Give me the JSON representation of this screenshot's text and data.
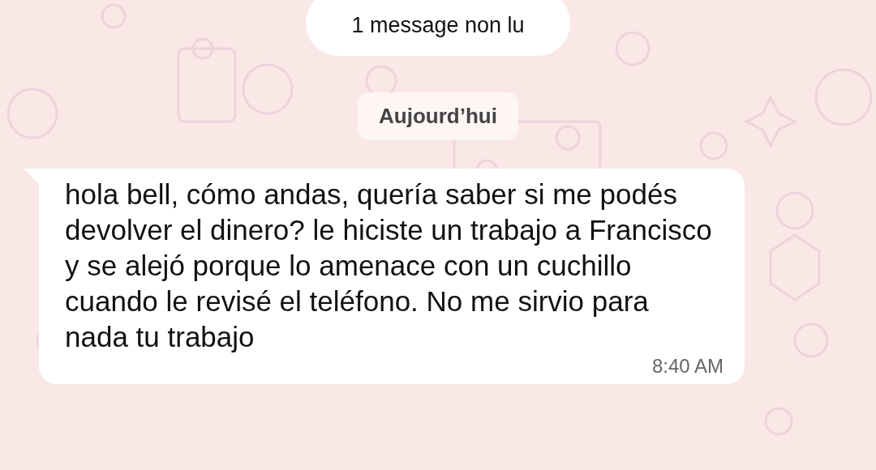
{
  "unread_banner": "1 message non lu",
  "date_chip": "Aujourd’hui",
  "message": {
    "text": "hola bell, cómo andas, quería saber si me podés devolver el dinero? le hiciste un trabajo a Francisco y se alejó porque lo amenace con un cuchillo cuando le revisé el teléfono. No me sirvio para nada tu trabajo",
    "time": "8:40 AM"
  }
}
